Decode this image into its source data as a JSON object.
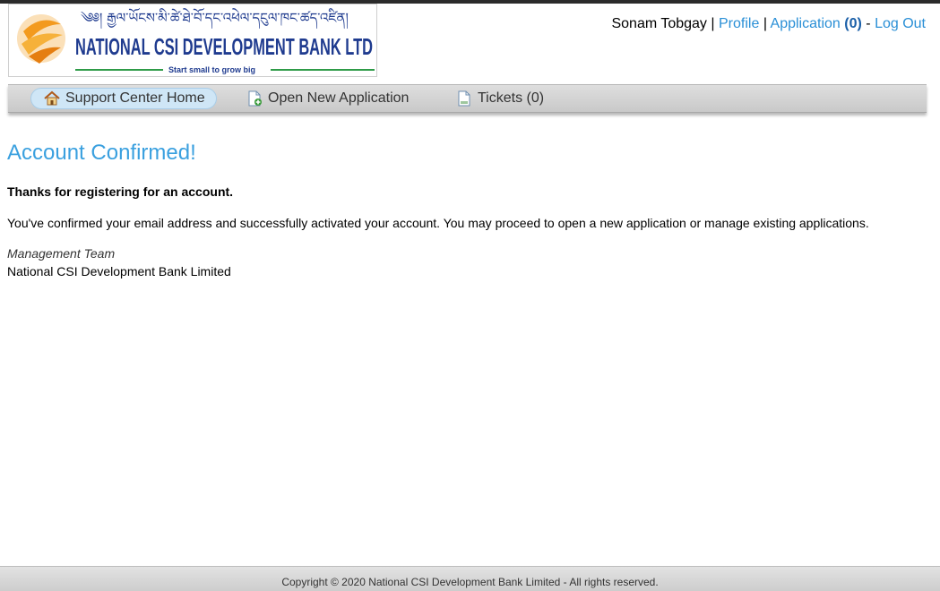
{
  "header": {
    "logo": {
      "tibetan_line": "༄༅། རྒྱལ་ཡོངས་མི་ཚེ་ཐེ་བོ་དང་འཕེལ་དངུལ་ཁང་ཚད་འཛིན།",
      "name": "NATIONAL CSI DEVELOPMENT BANK LTD",
      "tagline": "Start small to grow big",
      "colors": {
        "orange": "#f39a1e",
        "navy": "#1f3b8f",
        "green": "#2e9b48"
      }
    },
    "user": {
      "name": "Sonam Tobgay",
      "separator": "|",
      "profile_label": "Profile",
      "application_label": "Application",
      "application_count": "(0)",
      "dash": "-",
      "logout_label": "Log Out"
    }
  },
  "nav": {
    "items": [
      {
        "label": "Support Center Home",
        "icon": "home-icon",
        "active": true
      },
      {
        "label": "Open New Application",
        "icon": "new-document-icon",
        "active": false
      },
      {
        "label": "Tickets (0)",
        "icon": "document-icon",
        "active": false
      }
    ]
  },
  "main": {
    "title": "Account Confirmed!",
    "thanks": "Thanks for registering for an account.",
    "message": "You've confirmed your email address and successfully activated your account. You may proceed to open a new application or manage existing applications.",
    "signature": {
      "team": "Management Team",
      "org": "National CSI Development Bank Limited"
    }
  },
  "footer": {
    "copyright": "Copyright © 2020 National CSI Development Bank Limited - All rights reserved."
  },
  "colors": {
    "accent": "#3aa0df",
    "link": "#2a8fd6",
    "nav_bg": "#d4d4d4",
    "active_pill": "#cfe6f6"
  }
}
